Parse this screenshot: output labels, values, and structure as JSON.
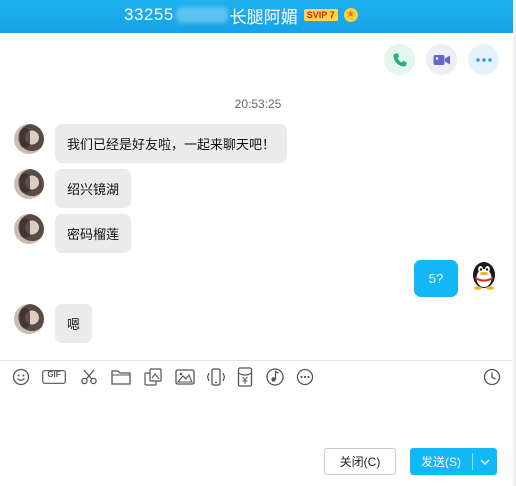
{
  "window": {
    "title_prefix": "33255",
    "title_name": "长腿阿媚",
    "vip_badge": "SVIP 7"
  },
  "top_actions": {
    "phone_icon": "phone-icon",
    "video_icon": "video-icon",
    "more_icon": "more-icon",
    "accent_color": "#12b7f5"
  },
  "chat": {
    "timestamp": "20:53:25",
    "messages": [
      {
        "direction": "in",
        "text": "我们已经是好友啦，一起来聊天吧！"
      },
      {
        "direction": "in",
        "text": "绍兴镜湖"
      },
      {
        "direction": "in",
        "text": "密码榴莲"
      },
      {
        "direction": "out",
        "text": "5?"
      },
      {
        "direction": "in",
        "text": "嗯"
      }
    ]
  },
  "toolbar": {
    "icons": [
      "emoji-icon",
      "gif-icon",
      "screenshot-scissors-icon",
      "folder-icon",
      "image-collage-icon",
      "picture-icon",
      "shake-icon",
      "red-packet-icon",
      "music-icon",
      "more-icon",
      "history-clock-icon"
    ],
    "gif_label": "GIF"
  },
  "footer": {
    "close_label": "关闭(C)",
    "send_label": "发送(S)"
  }
}
